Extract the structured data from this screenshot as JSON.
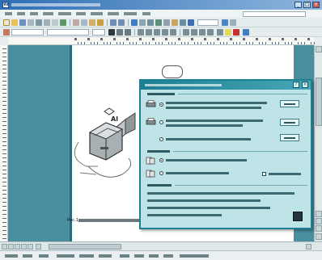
{
  "caption": {
    "text": "Рис.1"
  },
  "figure": {
    "cloud_text": ""
  },
  "dialog": {
    "buttons": [
      "",
      "",
      ""
    ]
  },
  "colors": {
    "accent": "#1f7f92",
    "dialog_bg": "#bfe4e8",
    "workspace": "#4a8fa0"
  },
  "icons": [
    "app-icon",
    "minimize-icon",
    "maximize-icon",
    "close-icon",
    "printer-icon",
    "help-icon",
    "dialog-close-icon"
  ]
}
